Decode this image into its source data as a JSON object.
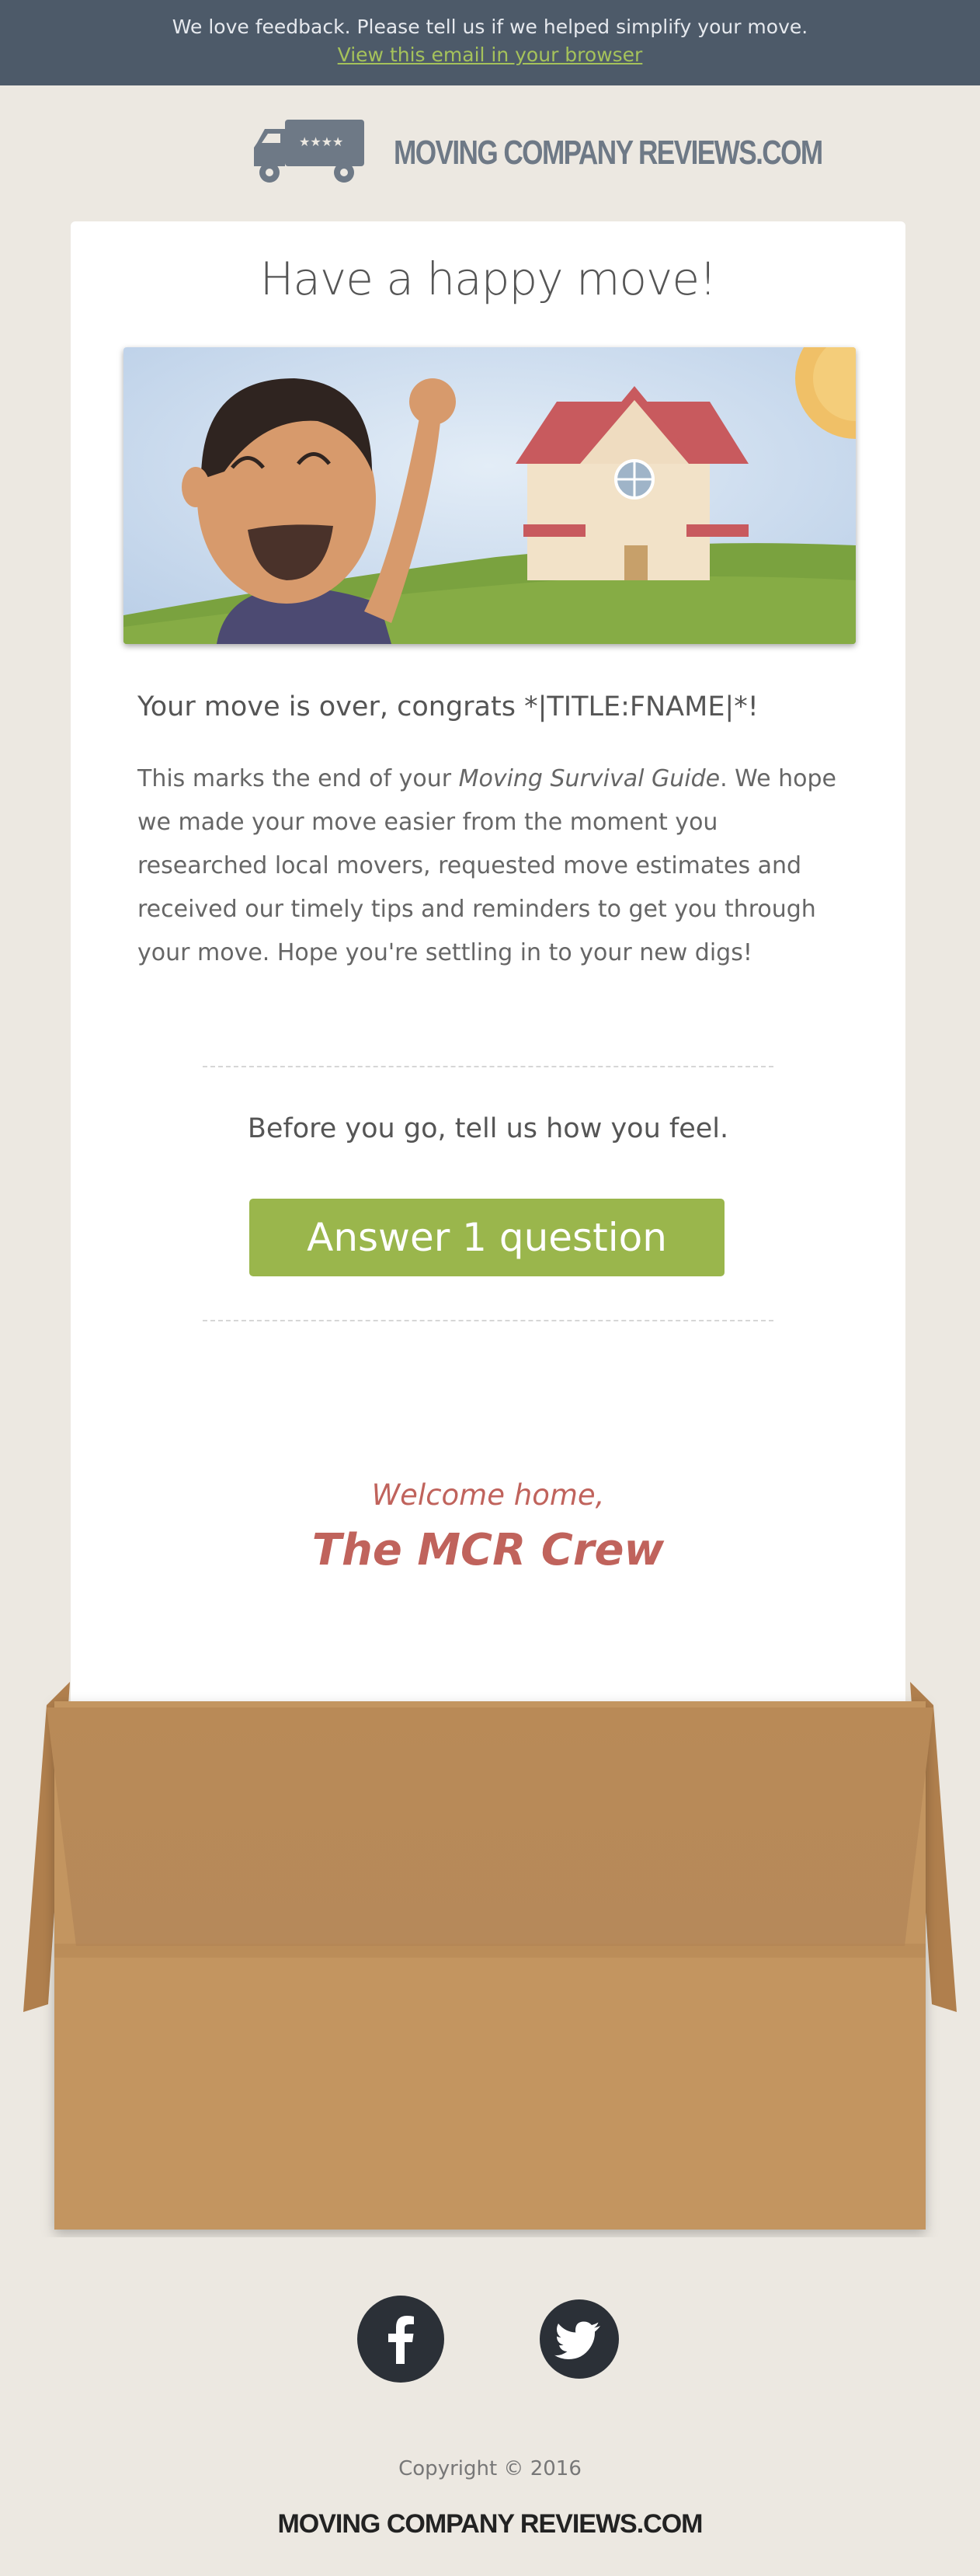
{
  "topbar": {
    "message": "We love feedback. Please tell us if we helped simplify your move.",
    "browser_link": "View this email in your browser"
  },
  "logo": {
    "text": "MOVING COMPANY REVIEWS.COM",
    "icon": "moving-truck-icon"
  },
  "card": {
    "headline": "Have a happy move!",
    "greeting": "Your move is over, congrats  *|TITLE:FNAME|*!",
    "body_prefix": "This marks the end of your ",
    "body_italic": "Moving Survival Guide",
    "body_suffix": ". We hope we made your move easier from the moment you researched local movers, requested move estimates and received our timely tips and reminders to get you through your move. Hope you're settling in to your new digs!",
    "before_you_go": "Before you go, tell us how you feel.",
    "cta_label": "Answer 1 question",
    "welcome": "Welcome home,",
    "signature": "The MCR Crew"
  },
  "social": {
    "facebook_icon": "facebook-icon",
    "twitter_icon": "twitter-icon"
  },
  "footer": {
    "copyright": "Copyright © 2016",
    "logo_text": "MOVING COMPANY REVIEWS.COM"
  },
  "colors": {
    "background": "#ece8e1",
    "topbar": "#4d5a69",
    "link": "#a5c25b",
    "button": "#9ab64c",
    "signature": "#c0635c",
    "box": "#c39560",
    "social": "#2b3037"
  }
}
